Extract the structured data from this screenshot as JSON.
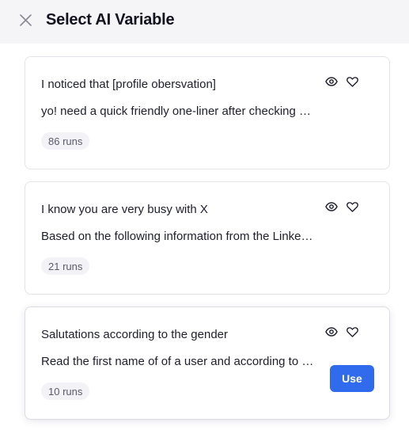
{
  "header": {
    "title": "Select AI Variable",
    "close_icon": "close-icon"
  },
  "variables": [
    {
      "title": "I noticed that [profile obersvation]",
      "description": "yo! need a quick friendly one-liner after checking out their LinkedIn profile",
      "runs": "86 runs"
    },
    {
      "title": "I know you are very busy with X",
      "description": "Based on the following information from the LinkedIn profile of the user",
      "runs": "21 runs"
    },
    {
      "title": "Salutations according to the gender",
      "description": "Read the first name of of a user and according to the gender write a salutation",
      "runs": "10 runs",
      "use_label": "Use"
    }
  ],
  "icons": {
    "preview": "eye-icon",
    "favorite": "heart-icon"
  },
  "colors": {
    "accent": "#2f6bec",
    "header_bg": "#f5f4f7",
    "badge_bg": "#f3f2f6"
  }
}
